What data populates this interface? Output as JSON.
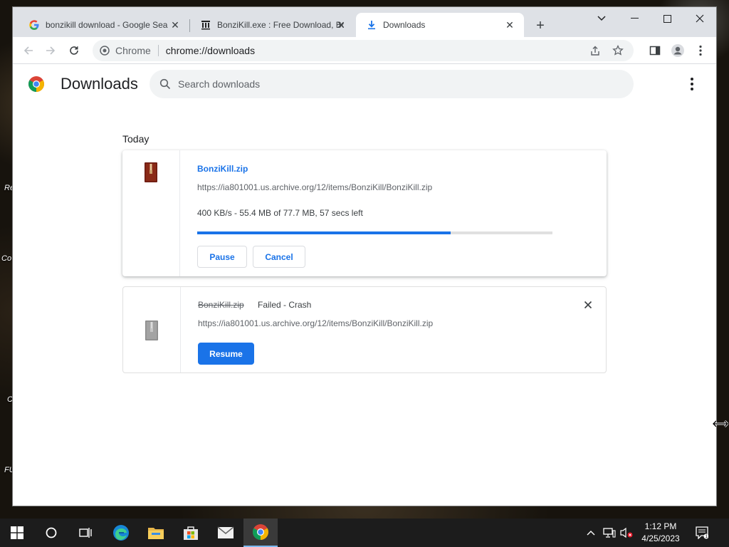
{
  "desktop": {
    "icon_labels": [
      "Re",
      "Co",
      "C",
      "FU"
    ]
  },
  "browser": {
    "tabs": [
      {
        "title": "bonzikill download - Google Search",
        "favicon": "google-g-icon",
        "active": false
      },
      {
        "title": "BonziKill.exe : Free Download, Borrow, and Streaming",
        "favicon": "archive-org-icon",
        "active": false
      },
      {
        "title": "Downloads",
        "favicon": "download-arrow-icon",
        "active": true
      }
    ],
    "omnibox": {
      "site_label": "Chrome",
      "url": "chrome://downloads"
    }
  },
  "downloads_page": {
    "title": "Downloads",
    "search_placeholder": "Search downloads",
    "section": "Today",
    "items": [
      {
        "filename": "BonziKill.zip",
        "url": "https://ia801001.us.archive.org/12/items/BonziKill/BonziKill.zip",
        "progress_text": "400 KB/s - 55.4 MB of 77.7 MB, 57 secs left",
        "progress_fraction": 0.713,
        "buttons": [
          "Pause",
          "Cancel"
        ],
        "state": "in-progress"
      },
      {
        "filename": "BonziKill.zip",
        "status": "Failed - Crash",
        "url": "https://ia801001.us.archive.org/12/items/BonziKill/BonziKill.zip",
        "buttons": [
          "Resume"
        ],
        "state": "failed"
      }
    ]
  },
  "taskbar": {
    "time": "1:12 PM",
    "date": "4/25/2023"
  },
  "colors": {
    "accent": "#1a73e8",
    "tabstrip": "#dee1e6",
    "taskbar": "#1c1c1c"
  }
}
